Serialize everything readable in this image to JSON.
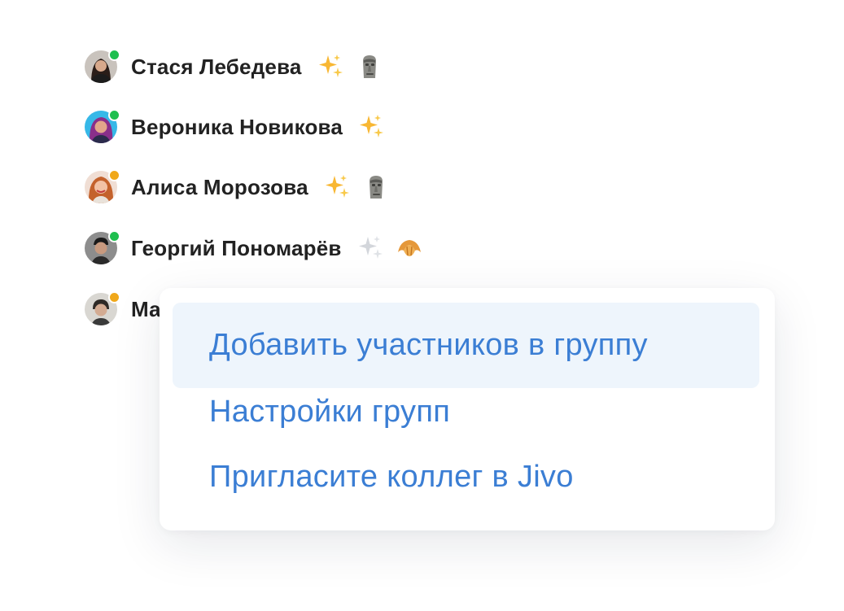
{
  "members": [
    {
      "name": "Стася Лебедева",
      "status": "online",
      "status_color": "#1fbf4f",
      "emojis": [
        "sparkles-emoji",
        "moai-emoji"
      ]
    },
    {
      "name": "Вероника Новикова",
      "status": "online",
      "status_color": "#1fbf4f",
      "emojis": [
        "sparkles-emoji"
      ]
    },
    {
      "name": "Алиса Морозова",
      "status": "away",
      "status_color": "#f0a81a",
      "emojis": [
        "sparkles-emoji",
        "moai-emoji"
      ]
    },
    {
      "name": "Георгий Пономарёв",
      "status": "online",
      "status_color": "#1fbf4f",
      "emojis": [
        "sparkles-faded-emoji",
        "croissant-emoji"
      ]
    },
    {
      "name": "Ма",
      "status": "away",
      "status_color": "#f0a81a",
      "emojis": []
    }
  ],
  "context_menu": {
    "items": [
      {
        "label": "Добавить участников в группу",
        "active": true
      },
      {
        "label": "Настройки групп",
        "active": false
      },
      {
        "label": "Пригласите коллег в Jivo",
        "active": false
      }
    ]
  },
  "colors": {
    "accent": "#3b7ed4",
    "hover_bg": "#eef5fc",
    "online": "#1fbf4f",
    "away": "#f0a81a"
  }
}
